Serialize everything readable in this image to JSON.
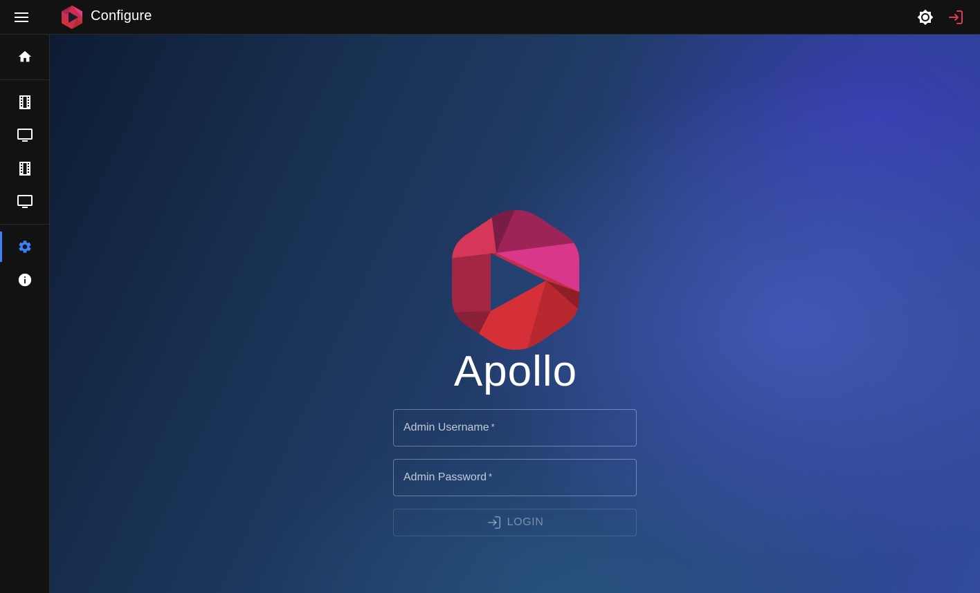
{
  "app": {
    "title": "Configure",
    "brand": "Apollo"
  },
  "sidebar": {
    "items": [
      {
        "name": "home",
        "icon": "home-icon"
      },
      {
        "name": "movies",
        "icon": "film-icon"
      },
      {
        "name": "tv",
        "icon": "tv-icon"
      },
      {
        "name": "movies-2",
        "icon": "film-icon"
      },
      {
        "name": "tv-2",
        "icon": "tv-icon"
      },
      {
        "name": "settings",
        "icon": "gear-icon",
        "active": true
      },
      {
        "name": "about",
        "icon": "info-icon"
      }
    ]
  },
  "login": {
    "username_label": "Admin Username",
    "password_label": "Admin Password",
    "required_mark": "*",
    "button_label": "LOGIN"
  },
  "colors": {
    "accent": "#3b82f6",
    "login_icon": "#e53950",
    "logo_primary": "#d8345a"
  }
}
